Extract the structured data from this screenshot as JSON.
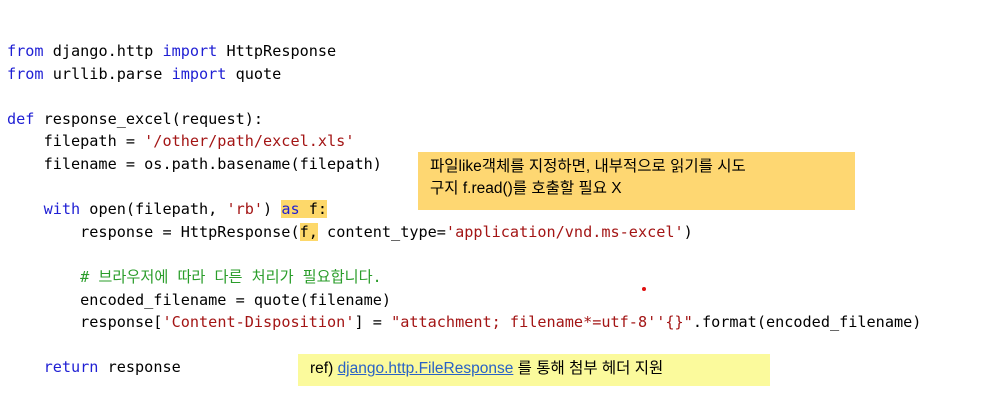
{
  "code": {
    "line1": {
      "kw1": "from",
      "mod": " django.http ",
      "kw2": "import",
      "name": " HttpResponse"
    },
    "line2": {
      "kw1": "from",
      "mod": " urllib.parse ",
      "kw2": "import",
      "name": " quote"
    },
    "line4": {
      "kw": "def",
      "rest": " response_excel(request):"
    },
    "line5": {
      "pre": "    filepath = ",
      "str": "'/other/path/excel.xls'"
    },
    "line6": {
      "text": "    filename = os.path.basename(filepath)"
    },
    "line8": {
      "indent": "    ",
      "kw": "with",
      "mid": " open(filepath, ",
      "str": "'rb'",
      "sp": ") ",
      "as_kw": "as",
      "as_var": " f:"
    },
    "line9": {
      "pre": "        response = HttpResponse(",
      "hl": "f,",
      "mid": " content_type=",
      "str": "'application/vnd.ms-excel'",
      "post": ")"
    },
    "line11": {
      "text": "        # 브라우저에 따라 다른 처리가 필요합니다."
    },
    "line12": {
      "text": "        encoded_filename = quote(filename)"
    },
    "line13": {
      "pre": "        response[",
      "str1": "'Content-Disposition'",
      "mid": "] = ",
      "str2": "\"attachment; filename*=utf-8''{}\"",
      "post": ".format(encoded_filename)"
    },
    "line15": {
      "indent": "    ",
      "kw": "return",
      "rest": " response"
    }
  },
  "notes": {
    "note1_line1": "파일like객체를 지정하면, 내부적으로 읽기를 시도",
    "note1_line2": "구지 f.read()를 호출할 필요 X",
    "note2_prefix": "ref)",
    "note2_link": "django.http.FileResponse",
    "note2_suffix": "를 통해 첨부 헤더 지원"
  },
  "colors": {
    "keyword": "#1f1fd4",
    "string": "#a31515",
    "comment": "#2a9d2a",
    "note1_bg": "#fed772",
    "note2_bg": "#fbfa9c",
    "link": "#2962c6"
  }
}
